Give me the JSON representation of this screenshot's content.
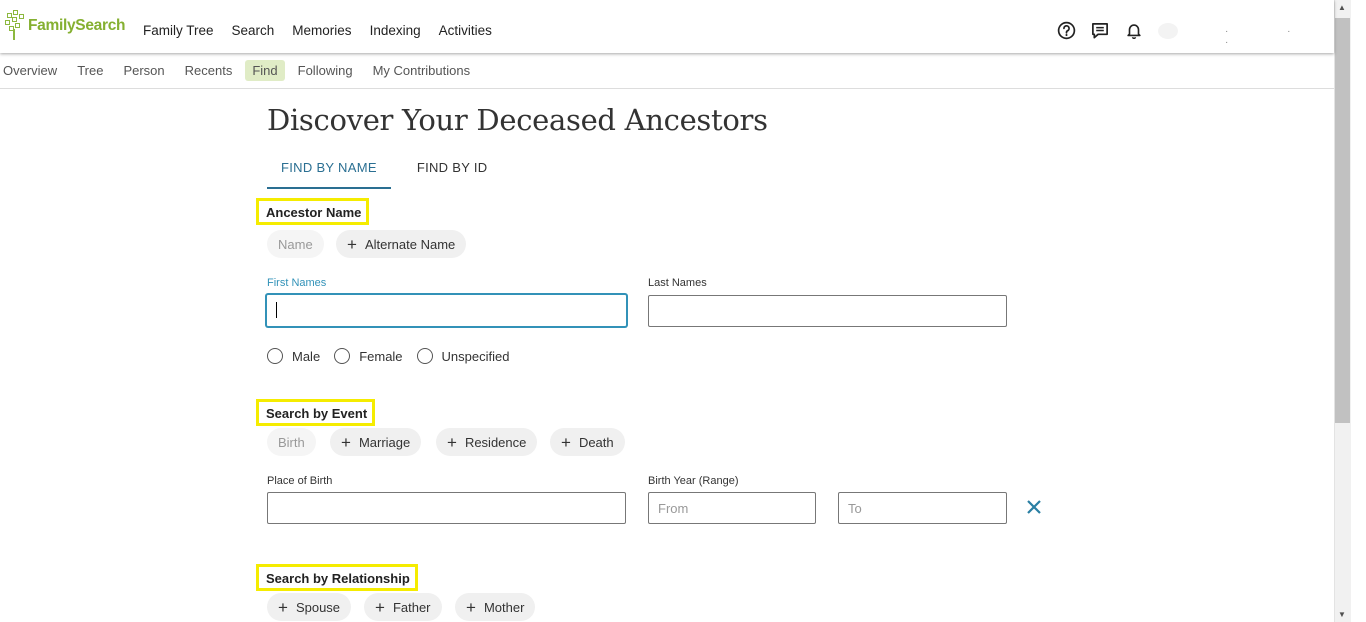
{
  "header": {
    "logo_text": "FamilySearch",
    "nav": [
      "Family Tree",
      "Search",
      "Memories",
      "Indexing",
      "Activities"
    ],
    "icons": [
      "help-icon",
      "chat-icon",
      "bell-icon"
    ]
  },
  "subnav": {
    "items": [
      "Overview",
      "Tree",
      "Person",
      "Recents",
      "Find",
      "Following",
      "My Contributions"
    ],
    "active": "Find"
  },
  "page": {
    "title": "Discover Your Deceased Ancestors",
    "tabs": [
      "FIND BY NAME",
      "FIND BY ID"
    ],
    "active_tab": "FIND BY NAME"
  },
  "ancestor": {
    "label": "Ancestor Name",
    "name_chip": "Name",
    "alternate_chip": "Alternate Name",
    "first_label": "First Names",
    "first_value": "",
    "last_label": "Last Names",
    "last_value": "",
    "genders": [
      "Male",
      "Female",
      "Unspecified"
    ]
  },
  "event": {
    "label": "Search by Event",
    "birth_chip": "Birth",
    "chips": [
      "Marriage",
      "Residence",
      "Death"
    ],
    "place_label": "Place of Birth",
    "place_value": "",
    "year_label": "Birth Year (Range)",
    "from_placeholder": "From",
    "to_placeholder": "To"
  },
  "relationship": {
    "label": "Search by Relationship",
    "chips": [
      "Spouse",
      "Father",
      "Mother"
    ]
  },
  "colors": {
    "accent": "#2a6f92",
    "focus": "#3292b8",
    "brand": "#85b031",
    "highlight": "#f5ec00"
  }
}
